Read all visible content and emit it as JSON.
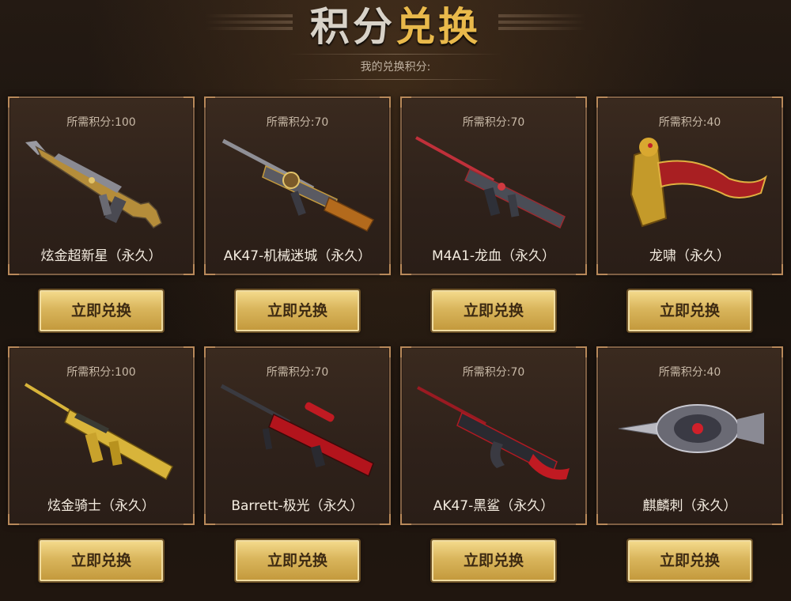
{
  "header": {
    "title_part1": "积分",
    "title_part2": "兑换",
    "points_label": "我的兑换积分:"
  },
  "items": [
    {
      "cost": "所需积分:100",
      "name": "炫金超新星（永久）",
      "button": "立即兑换",
      "icon": "rifle-gold-icon"
    },
    {
      "cost": "所需积分:70",
      "name": "AK47-机械迷城（永久）",
      "button": "立即兑换",
      "icon": "ak47-mech-icon"
    },
    {
      "cost": "所需积分:70",
      "name": "M4A1-龙血（永久）",
      "button": "立即兑换",
      "icon": "m4a1-dragon-icon"
    },
    {
      "cost": "所需积分:40",
      "name": "龙啸（永久）",
      "button": "立即兑换",
      "icon": "dragon-axe-icon"
    },
    {
      "cost": "所需积分:100",
      "name": "炫金骑士（永久）",
      "button": "立即兑换",
      "icon": "rifle-knight-icon"
    },
    {
      "cost": "所需积分:70",
      "name": "Barrett-极光（永久）",
      "button": "立即兑换",
      "icon": "barrett-sniper-icon"
    },
    {
      "cost": "所需积分:70",
      "name": "AK47-黑鲨（永久）",
      "button": "立即兑换",
      "icon": "ak47-shark-icon"
    },
    {
      "cost": "所需积分:40",
      "name": "麒麟刺（永久）",
      "button": "立即兑换",
      "icon": "qilin-blade-icon"
    }
  ],
  "colors": {
    "background": "#1c140f",
    "gold_button": "#d9b55c",
    "card_border": "#7e5f44",
    "title_gold": "#e9b94b"
  }
}
